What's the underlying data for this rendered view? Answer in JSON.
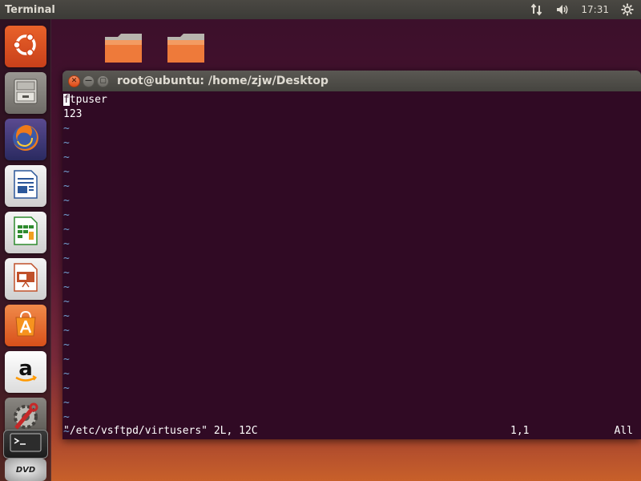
{
  "top_panel": {
    "app_title": "Terminal",
    "clock": "17:31",
    "icons": [
      "network-icon",
      "volume-icon",
      "gear-icon"
    ]
  },
  "launcher": {
    "items": [
      {
        "name": "ubuntu-dash",
        "icon": "ubuntu-logo-icon",
        "color": "#dd4814"
      },
      {
        "name": "files",
        "icon": "file-cabinet-icon",
        "color": "#8a8782"
      },
      {
        "name": "firefox",
        "icon": "firefox-icon",
        "color": "#e66000"
      },
      {
        "name": "libreoffice-writer",
        "icon": "writer-icon",
        "color": "#2b579a"
      },
      {
        "name": "libreoffice-calc",
        "icon": "calc-icon",
        "color": "#2e8b2e"
      },
      {
        "name": "libreoffice-impress",
        "icon": "impress-icon",
        "color": "#c0502a"
      },
      {
        "name": "ubuntu-software",
        "icon": "software-center-icon",
        "color": "#e95420"
      },
      {
        "name": "amazon",
        "icon": "amazon-icon",
        "color": "#ffffff"
      },
      {
        "name": "system-settings",
        "icon": "settings-wrench-icon",
        "color": "#6d6b66"
      },
      {
        "name": "terminal",
        "icon": "terminal-icon",
        "color": "#2c2c2c"
      },
      {
        "name": "dvd",
        "icon": "dvd-icon",
        "color": "#d0d0d0"
      }
    ],
    "dvd_label": "DVD"
  },
  "desktop": {
    "folders": [
      "folder-icon",
      "folder-icon"
    ]
  },
  "terminal": {
    "title": "root@ubuntu: /home/zjw/Desktop",
    "lines": [
      {
        "cursor_char": "f",
        "rest": "tpuser"
      },
      {
        "text": "123"
      }
    ],
    "tilde_count": 22,
    "tilde_char": "~",
    "status": {
      "file_info": "\"/etc/vsftpd/virtusers\" 2L, 12C",
      "position": "1,1",
      "scroll": "All"
    },
    "colors": {
      "background": "#300a24",
      "tilde": "#729fcf",
      "text": "#ffffff"
    }
  }
}
